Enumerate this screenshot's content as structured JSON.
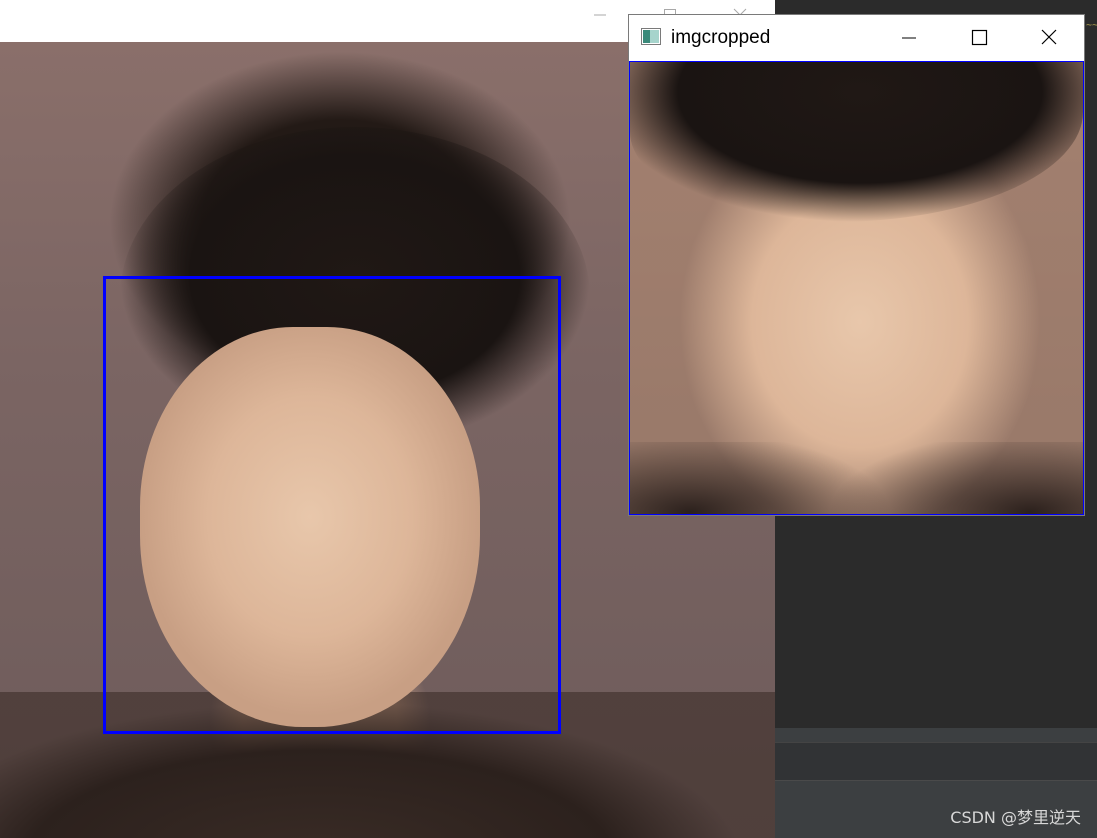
{
  "crop_window": {
    "title": "imgcropped",
    "app_icon": "opencv-window-icon",
    "minimize_icon": "minimize-icon",
    "maximize_icon": "maximize-icon",
    "close_icon": "close-icon"
  },
  "main_window": {
    "minimize_icon": "minimize-icon",
    "maximize_icon": "maximize-icon",
    "close_icon": "close-icon",
    "face_box_color": "#0000ff"
  },
  "colors": {
    "detection_box": "#0000ff",
    "ide_background": "#2b2b2b"
  },
  "watermark": "CSDN @梦里逆天"
}
